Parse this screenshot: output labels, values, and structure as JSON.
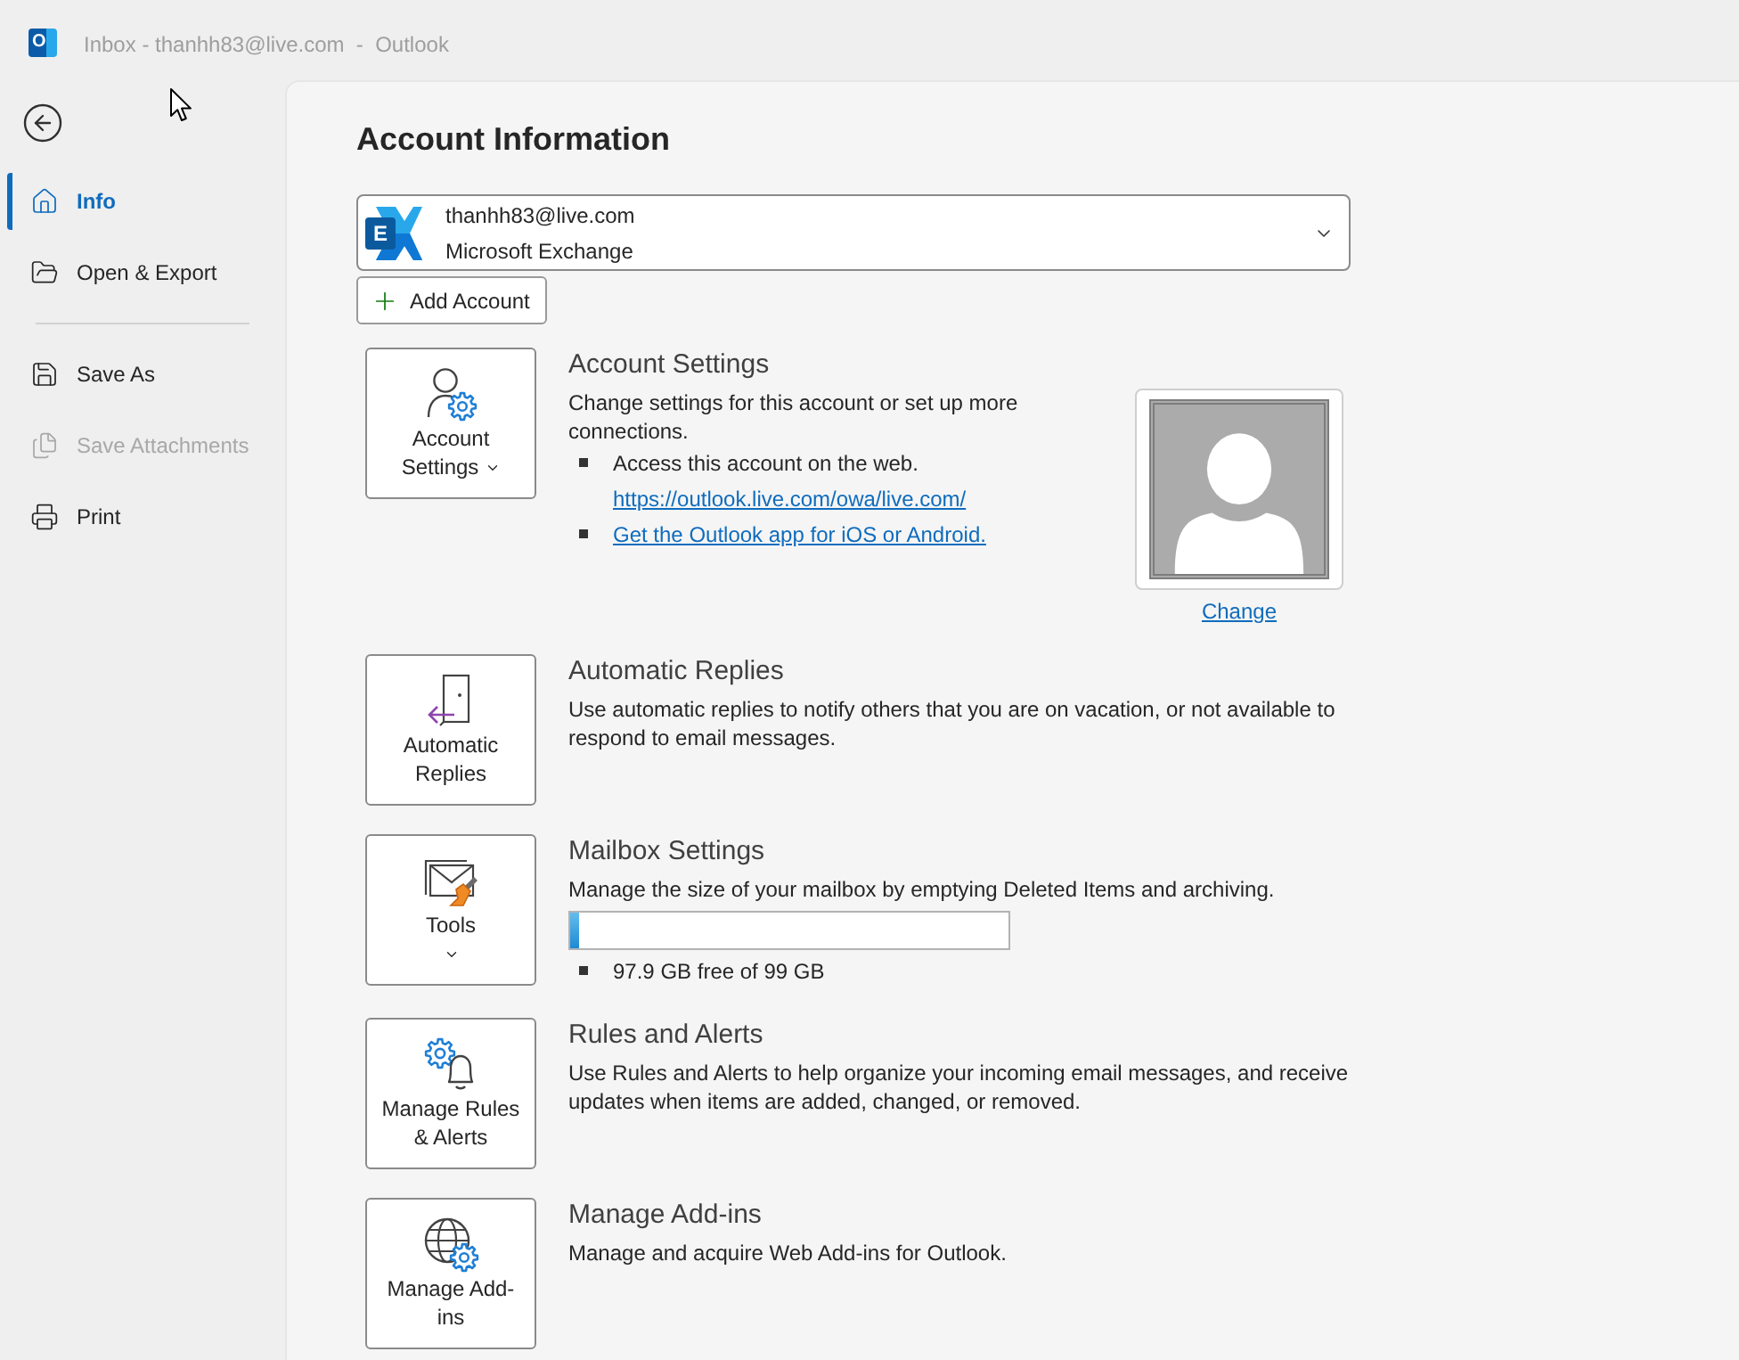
{
  "title_bar": {
    "logo_letter": "O",
    "title": "Inbox - thanhh83@live.com  -  Outlook"
  },
  "sidebar": {
    "groups": [
      {
        "items": [
          {
            "label": "Info",
            "selected": true,
            "disabled": false
          },
          {
            "label": "Open & Export",
            "selected": false,
            "disabled": false
          }
        ]
      },
      {
        "items": [
          {
            "label": "Save As",
            "selected": false,
            "disabled": false
          },
          {
            "label": "Save Attachments",
            "selected": false,
            "disabled": true
          },
          {
            "label": "Print",
            "selected": false,
            "disabled": false
          }
        ]
      }
    ]
  },
  "main": {
    "heading": "Account Information",
    "account": {
      "logo_letter": "E",
      "email": "thanhh83@live.com",
      "type": "Microsoft Exchange"
    },
    "add_account": "Add Account",
    "sections": [
      {
        "button": {
          "label": "Account Settings",
          "menu": true
        },
        "title": "Account Settings",
        "description": "Change settings for this account or set up more connections.",
        "bullets": [
          {
            "text": "Access this account on the web.",
            "link": "https://outlook.live.com/owa/live.com/"
          },
          {
            "link": "Get the Outlook app for iOS or Android."
          }
        ],
        "photo": {
          "change_link": "Change"
        }
      },
      {
        "button": {
          "label": "Automatic Replies",
          "menu": false
        },
        "title": "Automatic Replies",
        "description": "Use automatic replies to notify others that you are on vacation, or not available to respond to email messages."
      },
      {
        "button": {
          "label": "Tools",
          "menu": true
        },
        "title": "Mailbox Settings",
        "description": "Manage the size of your mailbox by emptying Deleted Items and archiving.",
        "usage_bar": {
          "level": 0.02
        },
        "bullets": [
          {
            "text": "97.9 GB free of 99 GB"
          }
        ]
      },
      {
        "button": {
          "label": "Manage Rules & Alerts",
          "menu": false
        },
        "title": "Rules and Alerts",
        "description": "Use Rules and Alerts to help organize your incoming email messages, and receive updates when items are added, changed, or removed."
      },
      {
        "button": {
          "label": "Manage Add-ins",
          "menu": false
        },
        "title": "Manage Add-ins",
        "description": "Manage and acquire Web Add-ins for Outlook."
      }
    ]
  }
}
